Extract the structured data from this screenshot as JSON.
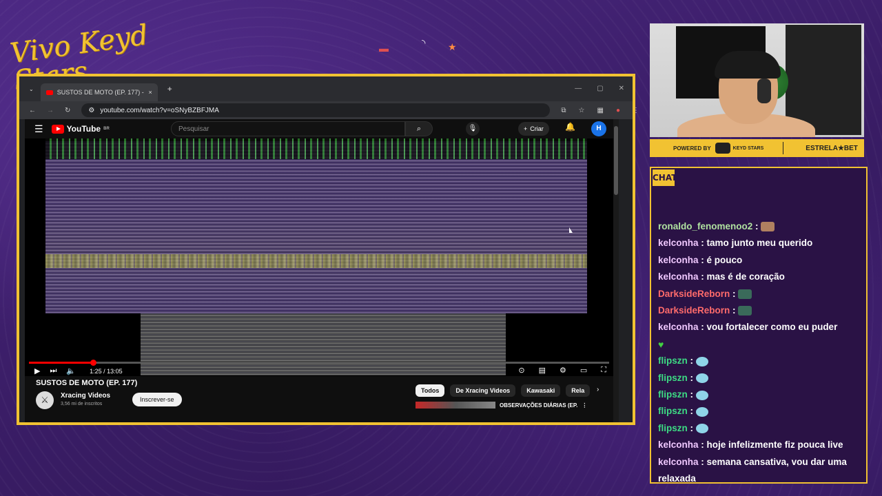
{
  "overlay": {
    "brand_logo_text": "Vivo Keyd Stars",
    "accent_color": "#f1c232",
    "background_color": "#3d1f6b"
  },
  "browser": {
    "tab_title": "SUSTOS DE MOTO (EP. 177) - Y",
    "new_tab_icon": "+",
    "close_tab_icon": "×",
    "url": "youtube.com/watch?v=oSNyBZBFJMA"
  },
  "youtube": {
    "logo_text": "YouTube",
    "region": "BR",
    "search_placeholder": "Pesquisar",
    "create_label": "Criar",
    "avatar_letter": "H",
    "player": {
      "progress_percent": 11,
      "time": "1:25 / 13:05"
    },
    "video_title": "SUSTOS DE MOTO (EP. 177)",
    "channel_name": "Xracing Videos",
    "channel_subs": "3,56 mi de inscritos",
    "subscribe_label": "Inscrever-se",
    "chips": [
      "Todos",
      "De Xracing Videos",
      "Kawasaki",
      "Rela"
    ],
    "recommended_title": "OBSERVAÇÕES DIÁRIAS (EP."
  },
  "sponsor": {
    "powered_by": "POWERED BY",
    "keyd_text": "KEYD STARS",
    "bet_text": "ESTRELA★BET"
  },
  "chat": {
    "header": "CHAT",
    "user_color": "#b0e2a0",
    "messages": [
      {
        "user": "ronaldo_fenomenoo2",
        "user_color": "#b0e2a0",
        "text": "",
        "emote": "face"
      },
      {
        "user": "kelconha",
        "user_color": "#f0c8ff",
        "text": "tamo junto meu querido",
        "emote": ""
      },
      {
        "user": "kelconha",
        "user_color": "#f0c8ff",
        "text": "é pouco",
        "emote": ""
      },
      {
        "user": "kelconha",
        "user_color": "#f0c8ff",
        "text": "mas é de coração",
        "emote": ""
      },
      {
        "user": "DarksideReborn",
        "user_color": "#ff6b6b",
        "text": "",
        "emote": "pc"
      },
      {
        "user": "DarksideReborn",
        "user_color": "#ff6b6b",
        "text": "",
        "emote": "pc"
      },
      {
        "user": "kelconha",
        "user_color": "#f0c8ff",
        "text": "vou fortalecer como eu puder",
        "emote": "heart"
      },
      {
        "user": "flipszn",
        "user_color": "#3ddc84",
        "text": "",
        "emote": "ghost"
      },
      {
        "user": "flipszn",
        "user_color": "#3ddc84",
        "text": "",
        "emote": "ghost"
      },
      {
        "user": "flipszn",
        "user_color": "#3ddc84",
        "text": "",
        "emote": "ghost"
      },
      {
        "user": "flipszn",
        "user_color": "#3ddc84",
        "text": "",
        "emote": "ghost"
      },
      {
        "user": "flipszn",
        "user_color": "#3ddc84",
        "text": "",
        "emote": "ghost"
      },
      {
        "user": "kelconha",
        "user_color": "#f0c8ff",
        "text": "hoje infelizmente fiz pouca live",
        "emote": ""
      },
      {
        "user": "kelconha",
        "user_color": "#f0c8ff",
        "text": "semana cansativa, vou dar uma relaxada",
        "emote": ""
      }
    ]
  }
}
